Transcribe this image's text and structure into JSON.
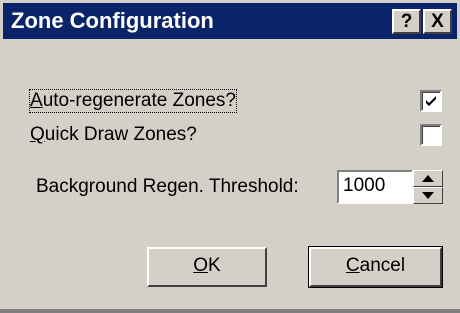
{
  "window": {
    "title": "Zone Configuration",
    "help_glyph": "?",
    "close_glyph": "X"
  },
  "options": {
    "auto_regenerate": {
      "label_mnemonic": "A",
      "label_rest": "uto-regenerate Zones?",
      "checked": true
    },
    "quick_draw": {
      "label_mnemonic": "Q",
      "label_rest": "uick Draw Zones?",
      "checked": false
    }
  },
  "threshold": {
    "label": "Background Regen. Threshold:",
    "value": "1000"
  },
  "buttons": {
    "ok_mnemonic": "O",
    "ok_rest": "K",
    "cancel_mnemonic": "C",
    "cancel_rest": "ancel"
  },
  "icons": {
    "help": "help-icon",
    "close": "close-icon",
    "check": "check-icon",
    "spin_up": "arrow-up-icon",
    "spin_down": "arrow-down-icon"
  }
}
